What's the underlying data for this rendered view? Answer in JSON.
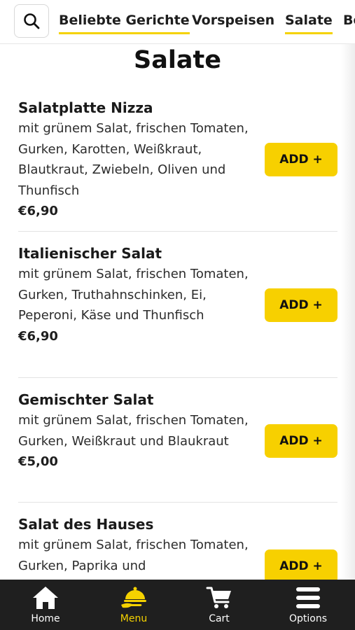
{
  "top_nav": {
    "tabs": [
      {
        "label": "Beliebte Gerichte"
      },
      {
        "label": "Vorspeisen"
      },
      {
        "label": "Salate"
      },
      {
        "label": "Be"
      }
    ],
    "active_tab": "Beliebte Gerichte"
  },
  "section": {
    "title": "Salate"
  },
  "items": [
    {
      "name": "Salatplatte Nizza",
      "description": "mit grünem Salat, frischen Tomaten, Gurken, Karotten, Weißkraut, Blautkraut, Zwiebeln, Oliven und Thunfisch",
      "price": "€6,90",
      "add_label": "ADD +"
    },
    {
      "name": "Italienischer Salat",
      "description": "mit grünem Salat, frischen Tomaten, Gurken, Truthahnschinken, Ei, Peperoni, Käse und Thunfisch",
      "price": "€6,90",
      "add_label": "ADD +"
    },
    {
      "name": "Gemischter Salat",
      "description": "mit grünem Salat, frischen Tomaten, Gurken, Weißkraut und Blaukraut",
      "price": "€5,00",
      "add_label": "ADD +"
    },
    {
      "name": "Salat des Hauses",
      "description": "mit grünem Salat, frischen Tomaten, Gurken, Paprika und",
      "price": "",
      "add_label": "ADD +"
    }
  ],
  "bottom_nav": {
    "items": [
      {
        "label": "Home",
        "icon": "home-icon"
      },
      {
        "label": "Menu",
        "icon": "menu-cloche-icon"
      },
      {
        "label": "Cart",
        "icon": "cart-icon"
      },
      {
        "label": "Options",
        "icon": "hamburger-icon"
      }
    ],
    "active": "Menu"
  },
  "colors": {
    "accent": "#f7d000",
    "nav_bg": "#1f1f1f",
    "text": "#1e1e1e"
  }
}
